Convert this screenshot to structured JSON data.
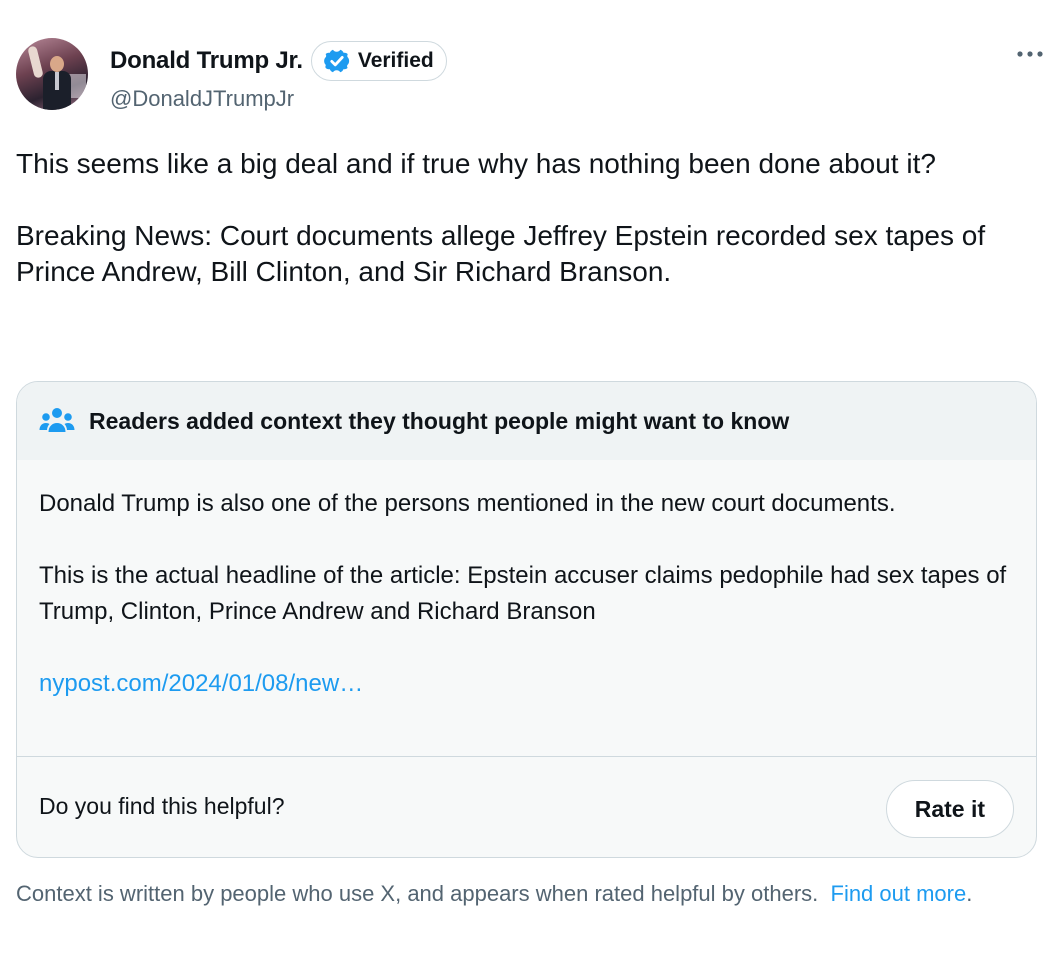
{
  "tweet": {
    "author_name": "Donald Trump Jr.",
    "verified_label": "Verified",
    "handle": "@DonaldJTrumpJr",
    "paragraphs": [
      "This seems like a big deal and if true why has nothing been done about it?",
      "Breaking News: Court documents allege Jeffrey Epstein recorded sex tapes of Prince Andrew, Bill Clinton, and Sir Richard Branson."
    ]
  },
  "community_note": {
    "title": "Readers added context they thought people might want to know",
    "paragraphs": [
      "Donald Trump is also one of the persons mentioned in the new court documents.",
      "This is the actual headline of the article: Epstein accuser claims pedophile had sex tapes of Trump, Clinton, Prince Andrew and Richard Branson"
    ],
    "link_text": "nypost.com/2024/01/08/new…",
    "helpful_prompt": "Do you find this helpful?",
    "rate_button": "Rate it"
  },
  "disclaimer": {
    "text": "Context is written by people who use X, and appears when rated helpful by others.",
    "link_text": "Find out more",
    "suffix": "."
  },
  "icons": {
    "verified": "verified-badge-icon",
    "more": "more-options-icon",
    "note": "people-group-icon"
  },
  "colors": {
    "accent": "#1d9bf0",
    "text": "#0f1419",
    "secondary": "#536471",
    "border": "#cfd9de"
  }
}
